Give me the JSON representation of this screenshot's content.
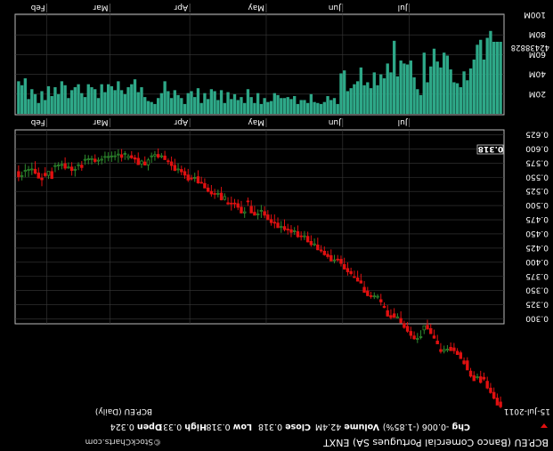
{
  "header": {
    "symbol_line": "BCP.EU (Banco Comercial Portugues SA) ENXT",
    "stats": [
      {
        "label": "Open",
        "value": "0.324"
      },
      {
        "label": "High",
        "value": "0.331"
      },
      {
        "label": "Low",
        "value": "0.318"
      },
      {
        "label": "Close",
        "value": "0.318"
      },
      {
        "label": "Volume",
        "value": "42.4M"
      },
      {
        "label": "Chg",
        "value": "-0.006 (-1.85%)"
      }
    ],
    "change_arrow": "down-arrow-icon",
    "watermark": "©StockCharts.com",
    "date": "15-Jul-2011",
    "chart_label": "BCP.EU (Daily)"
  },
  "colors": {
    "background": "#000000",
    "grid": "#3a3a3a",
    "frame": "#bbbbbb",
    "up_candle": "#2e8b2e",
    "down_candle": "#e01010",
    "volume": "#2ea888",
    "text": "#ffffff"
  },
  "volume_panel": {
    "y_ticks": [
      "20M",
      "40M",
      "60M",
      "80M",
      "100M"
    ],
    "current_volume_label": "42438828",
    "months": [
      "Feb",
      "Mar",
      "Apr",
      "May",
      "Jun",
      "Jul"
    ]
  },
  "price_panel": {
    "y_ticks": [
      "0.300",
      "0.325",
      "0.350",
      "0.375",
      "0.400",
      "0.425",
      "0.450",
      "0.475",
      "0.500",
      "0.525",
      "0.550",
      "0.575",
      "0.600",
      "0.625"
    ],
    "last_price_label": "0.318",
    "months": [
      "Feb",
      "Mar",
      "Apr",
      "May",
      "Jun",
      "Jul"
    ]
  },
  "chart_data": {
    "type": "candlestick",
    "title": "BCP.EU (Banco Comercial Portugues SA) ENXT",
    "series_label": "BCP.EU (Daily)",
    "rendered_rotated_180": true,
    "price_range": [
      0.293,
      0.632
    ],
    "volume_range": [
      0,
      100
    ],
    "volume_unit": "M",
    "x_months": [
      "Feb",
      "Mar",
      "Apr",
      "May",
      "Jun",
      "Jul"
    ],
    "month_start_index": [
      9,
      28,
      52,
      75,
      98,
      118
    ],
    "candles": [
      {
        "o": 0.56,
        "h": 0.571,
        "l": 0.543,
        "c": 0.551,
        "v": 33
      },
      {
        "o": 0.5512,
        "h": 0.56,
        "l": 0.5443,
        "c": 0.5519,
        "v": 29
      },
      {
        "o": 0.5603,
        "h": 0.5734,
        "l": 0.55,
        "c": 0.562,
        "v": 36
      },
      {
        "o": 0.5621,
        "h": 0.57,
        "l": 0.5506,
        "c": 0.5628,
        "v": 15
      },
      {
        "o": 0.563,
        "h": 0.576,
        "l": 0.554,
        "c": 0.564,
        "v": 25
      },
      {
        "o": 0.5641,
        "h": 0.5783,
        "l": 0.555,
        "c": 0.557,
        "v": 20
      },
      {
        "o": 0.5575,
        "h": 0.5671,
        "l": 0.5485,
        "c": 0.5484,
        "v": 11
      },
      {
        "o": 0.5485,
        "h": 0.5568,
        "l": 0.5342,
        "c": 0.5456,
        "v": 23
      },
      {
        "o": 0.557,
        "h": 0.5678,
        "l": 0.5497,
        "c": 0.5528,
        "v": 14
      },
      {
        "o": 0.5534,
        "h": 0.5601,
        "l": 0.547,
        "c": 0.5604,
        "v": 28
      },
      {
        "o": 0.56,
        "h": 0.5672,
        "l": 0.5469,
        "c": 0.5478,
        "v": 18
      },
      {
        "o": 0.569,
        "h": 0.5759,
        "l": 0.5589,
        "c": 0.5691,
        "v": 27
      },
      {
        "o": 0.57,
        "h": 0.5766,
        "l": 0.5626,
        "c": 0.5703,
        "v": 20
      },
      {
        "o": 0.571,
        "h": 0.5792,
        "l": 0.564,
        "c": 0.572,
        "v": 33
      },
      {
        "o": 0.5738,
        "h": 0.5851,
        "l": 0.5627,
        "c": 0.566,
        "v": 29
      },
      {
        "o": 0.5664,
        "h": 0.5763,
        "l": 0.5649,
        "c": 0.5674,
        "v": 16
      },
      {
        "o": 0.568,
        "h": 0.5766,
        "l": 0.5529,
        "c": 0.5619,
        "v": 24
      },
      {
        "o": 0.5624,
        "h": 0.5697,
        "l": 0.5511,
        "c": 0.564,
        "v": 27
      },
      {
        "o": 0.5704,
        "h": 0.5765,
        "l": 0.5626,
        "c": 0.5706,
        "v": 30
      },
      {
        "o": 0.5714,
        "h": 0.5785,
        "l": 0.5614,
        "c": 0.5671,
        "v": 21
      },
      {
        "o": 0.58,
        "h": 0.5899,
        "l": 0.5718,
        "c": 0.5809,
        "v": 17
      },
      {
        "o": 0.5808,
        "h": 0.589,
        "l": 0.5728,
        "c": 0.5812,
        "v": 30
      },
      {
        "o": 0.5813,
        "h": 0.5881,
        "l": 0.5725,
        "c": 0.5823,
        "v": 27
      },
      {
        "o": 0.582,
        "h": 0.5904,
        "l": 0.5749,
        "c": 0.5778,
        "v": 25
      },
      {
        "o": 0.5785,
        "h": 0.5851,
        "l": 0.5714,
        "c": 0.5795,
        "v": 16
      },
      {
        "o": 0.5802,
        "h": 0.5881,
        "l": 0.5727,
        "c": 0.5803,
        "v": 30
      },
      {
        "o": 0.585,
        "h": 0.5952,
        "l": 0.5753,
        "c": 0.5853,
        "v": 22
      },
      {
        "o": 0.585,
        "h": 0.5942,
        "l": 0.5781,
        "c": 0.5865,
        "v": 30
      },
      {
        "o": 0.586,
        "h": 0.5954,
        "l": 0.577,
        "c": 0.586,
        "v": 28
      },
      {
        "o": 0.5862,
        "h": 0.596,
        "l": 0.5797,
        "c": 0.587,
        "v": 24
      },
      {
        "o": 0.5893,
        "h": 0.5991,
        "l": 0.5758,
        "c": 0.59,
        "v": 33
      },
      {
        "o": 0.5897,
        "h": 0.5996,
        "l": 0.5777,
        "c": 0.585,
        "v": 24
      },
      {
        "o": 0.5903,
        "h": 0.5962,
        "l": 0.5807,
        "c": 0.5912,
        "v": 20
      },
      {
        "o": 0.5844,
        "h": 0.5915,
        "l": 0.5799,
        "c": 0.587,
        "v": 27
      },
      {
        "o": 0.588,
        "h": 0.596,
        "l": 0.5822,
        "c": 0.5844,
        "v": 30
      },
      {
        "o": 0.5843,
        "h": 0.5895,
        "l": 0.5753,
        "c": 0.582,
        "v": 35
      },
      {
        "o": 0.5834,
        "h": 0.5938,
        "l": 0.5717,
        "c": 0.5722,
        "v": 22
      },
      {
        "o": 0.5735,
        "h": 0.5809,
        "l": 0.5663,
        "c": 0.5786,
        "v": 27
      },
      {
        "o": 0.5769,
        "h": 0.5868,
        "l": 0.5726,
        "c": 0.5714,
        "v": 17
      },
      {
        "o": 0.5717,
        "h": 0.5843,
        "l": 0.562,
        "c": 0.5805,
        "v": 13
      },
      {
        "o": 0.5861,
        "h": 0.5935,
        "l": 0.5756,
        "c": 0.5865,
        "v": 12
      },
      {
        "o": 0.5876,
        "h": 0.5962,
        "l": 0.5792,
        "c": 0.59,
        "v": 10
      },
      {
        "o": 0.5903,
        "h": 0.6009,
        "l": 0.5828,
        "c": 0.5857,
        "v": 16
      },
      {
        "o": 0.5862,
        "h": 0.5926,
        "l": 0.5834,
        "c": 0.587,
        "v": 21
      },
      {
        "o": 0.5875,
        "h": 0.5967,
        "l": 0.5815,
        "c": 0.581,
        "v": 33
      },
      {
        "o": 0.5791,
        "h": 0.5831,
        "l": 0.572,
        "c": 0.5774,
        "v": 23
      },
      {
        "o": 0.5771,
        "h": 0.5865,
        "l": 0.5623,
        "c": 0.5706,
        "v": 16
      },
      {
        "o": 0.571,
        "h": 0.5825,
        "l": 0.5607,
        "c": 0.562,
        "v": 24
      },
      {
        "o": 0.563,
        "h": 0.5743,
        "l": 0.557,
        "c": 0.563,
        "v": 19
      },
      {
        "o": 0.5637,
        "h": 0.5705,
        "l": 0.5536,
        "c": 0.5596,
        "v": 16
      },
      {
        "o": 0.56,
        "h": 0.5669,
        "l": 0.5472,
        "c": 0.5537,
        "v": 10
      },
      {
        "o": 0.554,
        "h": 0.5647,
        "l": 0.5416,
        "c": 0.545,
        "v": 21
      },
      {
        "o": 0.548,
        "h": 0.5542,
        "l": 0.5441,
        "c": 0.547,
        "v": 23
      },
      {
        "o": 0.548,
        "h": 0.558,
        "l": 0.5418,
        "c": 0.5486,
        "v": 17
      },
      {
        "o": 0.551,
        "h": 0.5623,
        "l": 0.5384,
        "c": 0.54,
        "v": 26
      },
      {
        "o": 0.5397,
        "h": 0.5509,
        "l": 0.5391,
        "c": 0.5394,
        "v": 11
      },
      {
        "o": 0.539,
        "h": 0.548,
        "l": 0.533,
        "c": 0.531,
        "v": 21
      },
      {
        "o": 0.531,
        "h": 0.538,
        "l": 0.5233,
        "c": 0.525,
        "v": 15
      },
      {
        "o": 0.525,
        "h": 0.5363,
        "l": 0.5156,
        "c": 0.5205,
        "v": 25
      },
      {
        "o": 0.5202,
        "h": 0.5296,
        "l": 0.5118,
        "c": 0.5198,
        "v": 23
      },
      {
        "o": 0.52,
        "h": 0.5282,
        "l": 0.5145,
        "c": 0.52,
        "v": 14
      },
      {
        "o": 0.522,
        "h": 0.533,
        "l": 0.5093,
        "c": 0.51,
        "v": 24
      },
      {
        "o": 0.511,
        "h": 0.5217,
        "l": 0.5088,
        "c": 0.5158,
        "v": 11
      },
      {
        "o": 0.505,
        "h": 0.5147,
        "l": 0.5012,
        "c": 0.5028,
        "v": 22
      },
      {
        "o": 0.5036,
        "h": 0.5158,
        "l": 0.4913,
        "c": 0.5028,
        "v": 15
      },
      {
        "o": 0.5033,
        "h": 0.5117,
        "l": 0.4953,
        "c": 0.5029,
        "v": 20
      },
      {
        "o": 0.5034,
        "h": 0.5108,
        "l": 0.492,
        "c": 0.497,
        "v": 14
      },
      {
        "o": 0.4973,
        "h": 0.5082,
        "l": 0.486,
        "c": 0.4869,
        "v": 17
      },
      {
        "o": 0.487,
        "h": 0.4973,
        "l": 0.4783,
        "c": 0.489,
        "v": 11
      },
      {
        "o": 0.508,
        "h": 0.5142,
        "l": 0.4991,
        "c": 0.5066,
        "v": 25
      },
      {
        "o": 0.4986,
        "h": 0.5093,
        "l": 0.489,
        "c": 0.487,
        "v": 17
      },
      {
        "o": 0.4882,
        "h": 0.4993,
        "l": 0.4831,
        "c": 0.483,
        "v": 11
      },
      {
        "o": 0.4837,
        "h": 0.4932,
        "l": 0.4756,
        "c": 0.4853,
        "v": 21
      },
      {
        "o": 0.49,
        "h": 0.5012,
        "l": 0.4782,
        "c": 0.4915,
        "v": 10
      },
      {
        "o": 0.4894,
        "h": 0.4986,
        "l": 0.4778,
        "c": 0.483,
        "v": 16
      },
      {
        "o": 0.4836,
        "h": 0.492,
        "l": 0.4752,
        "c": 0.475,
        "v": 12
      },
      {
        "o": 0.4754,
        "h": 0.4843,
        "l": 0.4646,
        "c": 0.47,
        "v": 13
      },
      {
        "o": 0.4707,
        "h": 0.4844,
        "l": 0.4599,
        "c": 0.469,
        "v": 21
      },
      {
        "o": 0.4692,
        "h": 0.4791,
        "l": 0.4626,
        "c": 0.461,
        "v": 19
      },
      {
        "o": 0.4614,
        "h": 0.4727,
        "l": 0.4519,
        "c": 0.462,
        "v": 16
      },
      {
        "o": 0.463,
        "h": 0.4757,
        "l": 0.4545,
        "c": 0.4577,
        "v": 16
      },
      {
        "o": 0.4586,
        "h": 0.4678,
        "l": 0.4488,
        "c": 0.457,
        "v": 17
      },
      {
        "o": 0.4574,
        "h": 0.4655,
        "l": 0.4442,
        "c": 0.4527,
        "v": 15
      },
      {
        "o": 0.454,
        "h": 0.4621,
        "l": 0.4483,
        "c": 0.454,
        "v": 18
      },
      {
        "o": 0.454,
        "h": 0.465,
        "l": 0.443,
        "c": 0.445,
        "v": 10
      },
      {
        "o": 0.4456,
        "h": 0.4545,
        "l": 0.4384,
        "c": 0.445,
        "v": 14
      },
      {
        "o": 0.445,
        "h": 0.4551,
        "l": 0.4392,
        "c": 0.4452,
        "v": 14
      },
      {
        "o": 0.4457,
        "h": 0.454,
        "l": 0.435,
        "c": 0.4359,
        "v": 11
      },
      {
        "o": 0.4368,
        "h": 0.4476,
        "l": 0.4273,
        "c": 0.431,
        "v": 20
      },
      {
        "o": 0.4308,
        "h": 0.442,
        "l": 0.428,
        "c": 0.431,
        "v": 12
      },
      {
        "o": 0.4305,
        "h": 0.4434,
        "l": 0.4213,
        "c": 0.422,
        "v": 11
      },
      {
        "o": 0.4218,
        "h": 0.4302,
        "l": 0.4166,
        "c": 0.42,
        "v": 10
      },
      {
        "o": 0.4195,
        "h": 0.4279,
        "l": 0.4116,
        "c": 0.4133,
        "v": 12
      },
      {
        "o": 0.414,
        "h": 0.4202,
        "l": 0.4062,
        "c": 0.41,
        "v": 18
      },
      {
        "o": 0.4118,
        "h": 0.4227,
        "l": 0.4028,
        "c": 0.4022,
        "v": 14
      },
      {
        "o": 0.4026,
        "h": 0.4131,
        "l": 0.398,
        "c": 0.403,
        "v": 16
      },
      {
        "o": 0.4041,
        "h": 0.4128,
        "l": 0.401,
        "c": 0.404,
        "v": 10
      },
      {
        "o": 0.4052,
        "h": 0.4118,
        "l": 0.3925,
        "c": 0.398,
        "v": 41
      },
      {
        "o": 0.396,
        "h": 0.408,
        "l": 0.387,
        "c": 0.388,
        "v": 44
      },
      {
        "o": 0.389,
        "h": 0.3999,
        "l": 0.3766,
        "c": 0.3832,
        "v": 23
      },
      {
        "o": 0.3836,
        "h": 0.3904,
        "l": 0.3768,
        "c": 0.38,
        "v": 26
      },
      {
        "o": 0.3742,
        "h": 0.3853,
        "l": 0.3721,
        "c": 0.373,
        "v": 30
      },
      {
        "o": 0.3724,
        "h": 0.3851,
        "l": 0.3662,
        "c": 0.3667,
        "v": 33
      },
      {
        "o": 0.3671,
        "h": 0.3797,
        "l": 0.363,
        "c": 0.3632,
        "v": 47
      },
      {
        "o": 0.3558,
        "h": 0.3669,
        "l": 0.346,
        "c": 0.347,
        "v": 29
      },
      {
        "o": 0.3493,
        "h": 0.3565,
        "l": 0.34,
        "c": 0.341,
        "v": 32
      },
      {
        "o": 0.34,
        "h": 0.348,
        "l": 0.3357,
        "c": 0.3394,
        "v": 26
      },
      {
        "o": 0.339,
        "h": 0.347,
        "l": 0.3351,
        "c": 0.3392,
        "v": 42
      },
      {
        "o": 0.3384,
        "h": 0.3438,
        "l": 0.335,
        "c": 0.339,
        "v": 29
      },
      {
        "o": 0.334,
        "h": 0.3443,
        "l": 0.3237,
        "c": 0.33,
        "v": 40
      },
      {
        "o": 0.3224,
        "h": 0.3292,
        "l": 0.319,
        "c": 0.32,
        "v": 36
      },
      {
        "o": 0.3146,
        "h": 0.3243,
        "l": 0.3043,
        "c": 0.305,
        "v": 51
      },
      {
        "o": 0.306,
        "h": 0.317,
        "l": 0.299,
        "c": 0.3026,
        "v": 42
      },
      {
        "o": 0.309,
        "h": 0.319,
        "l": 0.3022,
        "c": 0.3025,
        "v": 74
      },
      {
        "o": 0.302,
        "h": 0.3099,
        "l": 0.3014,
        "c": 0.302,
        "v": 38
      },
      {
        "o": 0.3008,
        "h": 0.3134,
        "l": 0.2919,
        "c": 0.2935,
        "v": 54
      },
      {
        "o": 0.292,
        "h": 0.297,
        "l": 0.2826,
        "c": 0.285,
        "v": 51
      },
      {
        "o": 0.287,
        "h": 0.2948,
        "l": 0.2756,
        "c": 0.2783,
        "v": 50
      },
      {
        "o": 0.278,
        "h": 0.2863,
        "l": 0.265,
        "c": 0.271,
        "v": 54
      },
      {
        "o": 0.27,
        "h": 0.278,
        "l": 0.2633,
        "c": 0.265,
        "v": 37
      },
      {
        "o": 0.264,
        "h": 0.2753,
        "l": 0.2574,
        "c": 0.264,
        "v": 25
      },
      {
        "o": 0.2673,
        "h": 0.2801,
        "l": 0.264,
        "c": 0.268,
        "v": 19
      },
      {
        "o": 0.2807,
        "h": 0.2842,
        "l": 0.2732,
        "c": 0.288,
        "v": 62
      },
      {
        "o": 0.2888,
        "h": 0.2986,
        "l": 0.2821,
        "c": 0.282,
        "v": 32
      },
      {
        "o": 0.283,
        "h": 0.2912,
        "l": 0.2756,
        "c": 0.274,
        "v": 48
      },
      {
        "o": 0.27,
        "h": 0.2812,
        "l": 0.2651,
        "c": 0.266,
        "v": 66
      },
      {
        "o": 0.261,
        "h": 0.2719,
        "l": 0.2584,
        "c": 0.256,
        "v": 53
      },
      {
        "o": 0.246,
        "h": 0.2573,
        "l": 0.239,
        "c": 0.2425,
        "v": 47
      },
      {
        "o": 0.243,
        "h": 0.253,
        "l": 0.2391,
        "c": 0.246,
        "v": 62
      },
      {
        "o": 0.245,
        "h": 0.2538,
        "l": 0.2413,
        "c": 0.245,
        "v": 59
      },
      {
        "o": 0.25,
        "h": 0.2585,
        "l": 0.2468,
        "c": 0.244,
        "v": 45
      },
      {
        "o": 0.2489,
        "h": 0.2576,
        "l": 0.2385,
        "c": 0.244,
        "v": 32
      },
      {
        "o": 0.2429,
        "h": 0.2485,
        "l": 0.2365,
        "c": 0.2372,
        "v": 31
      },
      {
        "o": 0.2403,
        "h": 0.2439,
        "l": 0.2327,
        "c": 0.23,
        "v": 27
      },
      {
        "o": 0.226,
        "h": 0.2321,
        "l": 0.2189,
        "c": 0.221,
        "v": 43
      },
      {
        "o": 0.226,
        "h": 0.2324,
        "l": 0.2128,
        "c": 0.21,
        "v": 34
      },
      {
        "o": 0.208,
        "h": 0.2136,
        "l": 0.1965,
        "c": 0.199,
        "v": 46
      },
      {
        "o": 0.2,
        "h": 0.2078,
        "l": 0.194,
        "c": 0.191,
        "v": 55
      },
      {
        "o": 0.1963,
        "h": 0.2036,
        "l": 0.1931,
        "c": 0.197,
        "v": 70
      },
      {
        "o": 0.198,
        "h": 0.2085,
        "l": 0.186,
        "c": 0.188,
        "v": 75
      },
      {
        "o": 0.197,
        "h": 0.2053,
        "l": 0.1908,
        "c": 0.194,
        "v": 55
      },
      {
        "o": 0.19,
        "h": 0.198,
        "l": 0.1759,
        "c": 0.1781,
        "v": 77
      },
      {
        "o": 0.178,
        "h": 0.187,
        "l": 0.168,
        "c": 0.17,
        "v": 84
      },
      {
        "o": 0.1704,
        "h": 0.179,
        "l": 0.158,
        "c": 0.16,
        "v": 73
      },
      {
        "o": 0.1604,
        "h": 0.1684,
        "l": 0.1491,
        "c": 0.148,
        "v": 73
      },
      {
        "o": 0.1534,
        "h": 0.1631,
        "l": 0.1423,
        "c": 0.145,
        "v": 73
      }
    ]
  }
}
